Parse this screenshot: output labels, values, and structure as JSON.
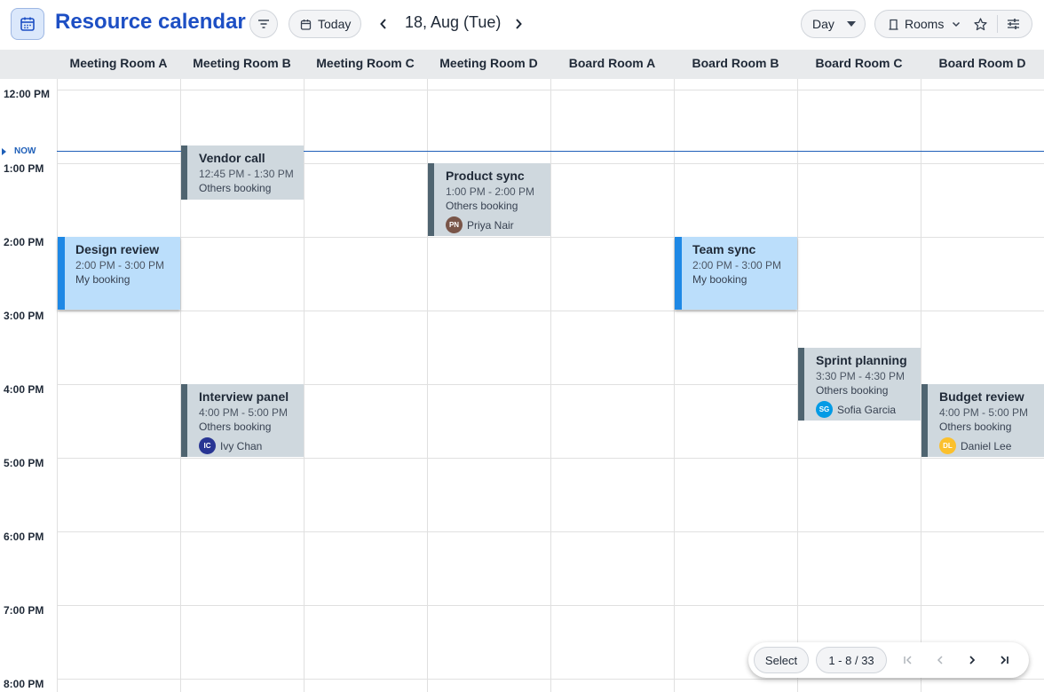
{
  "header": {
    "app_icon": "calendar-icon",
    "title": "Resource calendar",
    "filter_icon": "filter-icon",
    "today_label": "Today",
    "today_icon": "calendar-small-icon",
    "prev_icon": "chevron-left-icon",
    "date": "18, Aug (Tue)",
    "next_icon": "chevron-right-icon",
    "view_label": "Day",
    "view_icon": "caret-down-icon",
    "resource_label": "Rooms",
    "resource_icon": "door-icon",
    "favorite_icon": "star-icon",
    "settings_icon": "sliders-icon"
  },
  "columns": [
    "Meeting Room A",
    "Meeting Room B",
    "Meeting Room C",
    "Meeting Room D",
    "Board Room A",
    "Board Room B",
    "Board Room C",
    "Board Room D"
  ],
  "time_labels": [
    "12:00 PM",
    "1:00 PM",
    "2:00 PM",
    "3:00 PM",
    "4:00 PM",
    "5:00 PM",
    "6:00 PM",
    "7:00 PM",
    "8:00 PM"
  ],
  "now_label": "NOW",
  "events": [
    {
      "title": "Vendor call",
      "time": "12:45 PM - 1:30 PM",
      "kind": "Others booking",
      "person": null
    },
    {
      "title": "Product sync",
      "time": "1:00 PM - 2:00 PM",
      "kind": "Others booking",
      "person": {
        "initials": "PN",
        "name": "Priya Nair",
        "color": "#795548"
      }
    },
    {
      "title": "Design review",
      "time": "2:00 PM - 3:00 PM",
      "kind": "My booking",
      "person": null
    },
    {
      "title": "Team sync",
      "time": "2:00 PM - 3:00 PM",
      "kind": "My booking",
      "person": null
    },
    {
      "title": "Sprint planning",
      "time": "3:30 PM - 4:30 PM",
      "kind": "Others booking",
      "person": {
        "initials": "SG",
        "name": "Sofia Garcia",
        "color": "#039be5"
      }
    },
    {
      "title": "Interview panel",
      "time": "4:00 PM - 5:00 PM",
      "kind": "Others booking",
      "person": {
        "initials": "IC",
        "name": "Ivy Chan",
        "color": "#283593"
      }
    },
    {
      "title": "Budget review",
      "time": "4:00 PM - 5:00 PM",
      "kind": "Others booking",
      "person": {
        "initials": "DL",
        "name": "Daniel Lee",
        "color": "#fbc02d"
      }
    }
  ],
  "colors": {
    "accent": "#1d4fc4",
    "now_line": "#1e5fb8",
    "my_booking_bg": "#bbdefb",
    "my_booking_bar": "#1e88e5",
    "others_booking_bg": "#cfd8de",
    "others_booking_bar": "#4f6470"
  },
  "pager": {
    "select_label": "Select",
    "range_label": "1 - 8 / 33",
    "first_icon": "first-page-icon",
    "prev_icon": "chevron-left-icon",
    "next_icon": "chevron-right-icon",
    "last_icon": "last-page-icon"
  }
}
